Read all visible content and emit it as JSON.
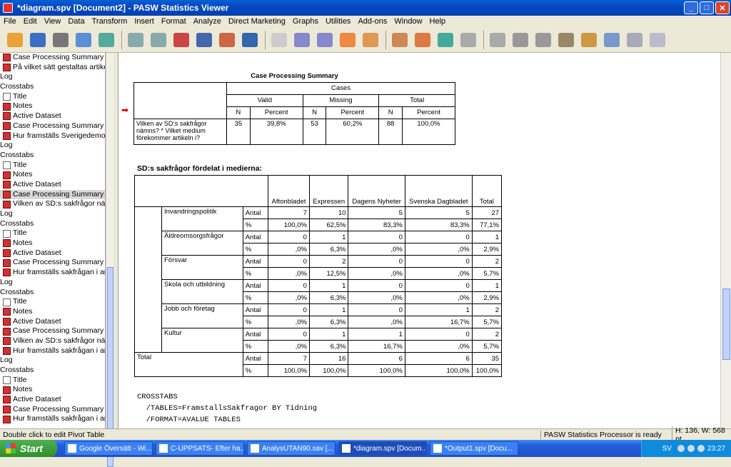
{
  "window": {
    "title": "*diagram.spv [Document2] - PASW Statistics Viewer"
  },
  "menu": [
    "File",
    "Edit",
    "View",
    "Data",
    "Transform",
    "Insert",
    "Format",
    "Analyze",
    "Direct Marketing",
    "Graphs",
    "Utilities",
    "Add-ons",
    "Window",
    "Help"
  ],
  "nav": [
    {
      "label": "Case Processing Summary",
      "icon": "red"
    },
    {
      "label": "På vilket sätt gestaltas artikel",
      "icon": "red"
    },
    {
      "label": "Log",
      "icon": "none"
    },
    {
      "label": "Crosstabs",
      "icon": "none"
    },
    {
      "label": "Title",
      "icon": "white"
    },
    {
      "label": "Notes",
      "icon": "red"
    },
    {
      "label": "Active Dataset",
      "icon": "red"
    },
    {
      "label": "Case Processing Summary",
      "icon": "red"
    },
    {
      "label": "Hur framställs Sverigedemok",
      "icon": "red"
    },
    {
      "label": "Log",
      "icon": "none"
    },
    {
      "label": "Crosstabs",
      "icon": "none"
    },
    {
      "label": "Title",
      "icon": "white"
    },
    {
      "label": "Notes",
      "icon": "red"
    },
    {
      "label": "Active Dataset",
      "icon": "red"
    },
    {
      "label": "Case Processing Summary",
      "icon": "red",
      "selected": true
    },
    {
      "label": "Vilken av SD:s sakfrågor näm",
      "icon": "red"
    },
    {
      "label": "Log",
      "icon": "none"
    },
    {
      "label": "Crosstabs",
      "icon": "none"
    },
    {
      "label": "Title",
      "icon": "white"
    },
    {
      "label": "Notes",
      "icon": "red"
    },
    {
      "label": "Active Dataset",
      "icon": "red"
    },
    {
      "label": "Case Processing Summary",
      "icon": "red"
    },
    {
      "label": "Hur framställs sakfrågan i ar",
      "icon": "red"
    },
    {
      "label": "Log",
      "icon": "none"
    },
    {
      "label": "Crosstabs",
      "icon": "none"
    },
    {
      "label": "Title",
      "icon": "white"
    },
    {
      "label": "Notes",
      "icon": "red"
    },
    {
      "label": "Active Dataset",
      "icon": "red"
    },
    {
      "label": "Case Processing Summary",
      "icon": "red"
    },
    {
      "label": "Vilken av SD:s sakfrågor näm",
      "icon": "red"
    },
    {
      "label": "Hur framställs sakfrågan i ar",
      "icon": "red"
    },
    {
      "label": "Log",
      "icon": "none"
    },
    {
      "label": "Crosstabs",
      "icon": "none"
    },
    {
      "label": "Title",
      "icon": "white"
    },
    {
      "label": "Notes",
      "icon": "red"
    },
    {
      "label": "Active Dataset",
      "icon": "red"
    },
    {
      "label": "Case Processing Summary",
      "icon": "red"
    },
    {
      "label": "Hur framställs sakfrågan i ar",
      "icon": "red"
    }
  ],
  "case": {
    "title": "Case Processing Summary",
    "cases": "Cases",
    "valid": "Valid",
    "missing": "Missing",
    "total": "Total",
    "n": "N",
    "percent": "Percent",
    "row_label": "Vilken av SD:s sakfrågor nämns? * Vilket medium förekommer artikeln i?",
    "vals": [
      "35",
      "39,8%",
      "53",
      "60,2%",
      "88",
      "100,0%"
    ]
  },
  "cross": {
    "title": "SD:s sakfrågor fördelat i medierna:",
    "cols": [
      "Aftonbladet",
      "Expressen",
      "Dagens Nyheter",
      "Svenska Dagbladet",
      "Total"
    ],
    "antal": "Antal",
    "pct": "%",
    "rows": [
      {
        "label": "Invandringspolitik",
        "antal": [
          "7",
          "10",
          "5",
          "5",
          "27"
        ],
        "pct": [
          "100,0%",
          "62,5%",
          "83,3%",
          "83,3%",
          "77,1%"
        ]
      },
      {
        "label": "Äldreomsorgsfrågor",
        "antal": [
          "0",
          "1",
          "0",
          "0",
          "1"
        ],
        "pct": [
          ",0%",
          "6,3%",
          ",0%",
          ",0%",
          "2,9%"
        ]
      },
      {
        "label": "Försvar",
        "antal": [
          "0",
          "2",
          "0",
          "0",
          "2"
        ],
        "pct": [
          ",0%",
          "12,5%",
          ",0%",
          ",0%",
          "5,7%"
        ]
      },
      {
        "label": "Skola och utbildning",
        "antal": [
          "0",
          "1",
          "0",
          "0",
          "1"
        ],
        "pct": [
          ",0%",
          "6,3%",
          ",0%",
          ",0%",
          "2,9%"
        ]
      },
      {
        "label": "Jobb och företag",
        "antal": [
          "0",
          "1",
          "0",
          "1",
          "2"
        ],
        "pct": [
          ",0%",
          "6,3%",
          ",0%",
          "16,7%",
          "5,7%"
        ]
      },
      {
        "label": "Kultur",
        "antal": [
          "0",
          "1",
          "1",
          "0",
          "2"
        ],
        "pct": [
          ",0%",
          "6,3%",
          "16,7%",
          ",0%",
          "5,7%"
        ]
      }
    ],
    "total": {
      "label": "Total",
      "antal": [
        "7",
        "16",
        "6",
        "6",
        "35"
      ],
      "pct": [
        "100,0%",
        "100,0%",
        "100,0%",
        "100,0%",
        "100,0%"
      ]
    }
  },
  "syntax": [
    "CROSSTABS",
    "  /TABLES=FramstallsSakfragor BY Tidning",
    "  /FORMAT=AVALUE TABLES"
  ],
  "status": {
    "left": "Double click to edit Pivot Table",
    "middle": "PASW Statistics Processor is ready",
    "right": "H: 136, W: 568 pt."
  },
  "taskbar": {
    "start": "Start",
    "tasks": [
      "Google Översätt - Wi...",
      "C-UPPSATS- Efter ha...",
      "AnalysUTAN90.sav [...",
      "*diagram.spv [Docum...",
      "*Output1.spv [Docu..."
    ],
    "lang": "SV",
    "clock": "23:27"
  }
}
